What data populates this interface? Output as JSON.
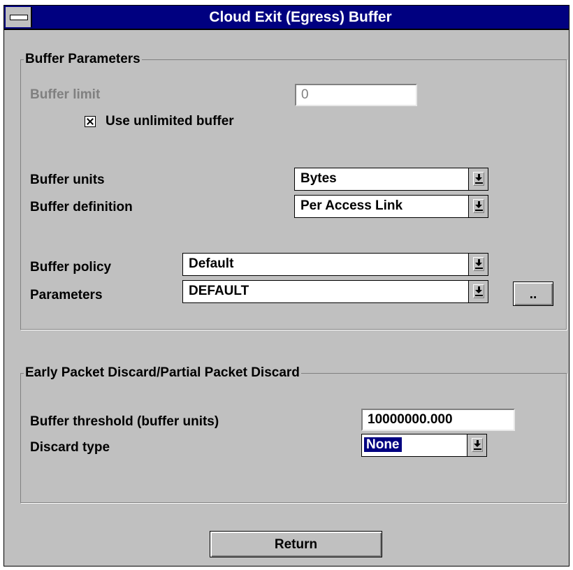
{
  "window": {
    "title": "Cloud Exit (Egress) Buffer"
  },
  "buffer_parameters": {
    "group_label": "Buffer Parameters",
    "buffer_limit_label": "Buffer limit",
    "buffer_limit_value": "0",
    "unlimited_label": "Use unlimited buffer",
    "unlimited_checked": true,
    "units_label": "Buffer units",
    "units_value": "Bytes",
    "definition_label": "Buffer definition",
    "definition_value": "Per Access Link",
    "policy_label": "Buffer policy",
    "policy_value": "Default",
    "parameters_label": "Parameters",
    "parameters_value": "DEFAULT",
    "ellipsis_label": ".."
  },
  "epd_ppd": {
    "group_label": "Early Packet Discard/Partial Packet Discard",
    "threshold_label": "Buffer threshold (buffer units)",
    "threshold_value": "10000000.000",
    "discard_type_label": "Discard type",
    "discard_type_value": "None"
  },
  "footer": {
    "return_label": "Return"
  }
}
